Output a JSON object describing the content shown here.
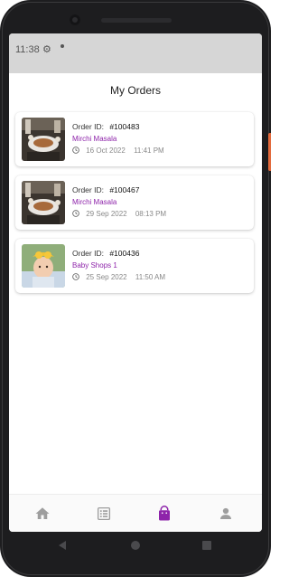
{
  "status_bar": {
    "time": "11:38"
  },
  "header": {
    "title": "My Orders"
  },
  "orders": [
    {
      "id_label": "Order ID:",
      "id": "#100483",
      "restaurant": "Mirchi Masala",
      "date": "16 Oct 2022",
      "time": "11:41 PM"
    },
    {
      "id_label": "Order ID:",
      "id": "#100467",
      "restaurant": "Mirchi Masala",
      "date": "29 Sep 2022",
      "time": "08:13 PM"
    },
    {
      "id_label": "Order ID:",
      "id": "#100436",
      "restaurant": "Baby Shops 1",
      "date": "25 Sep 2022",
      "time": "11:50 AM"
    }
  ],
  "bottom_nav": {
    "items": [
      "home-icon",
      "menu-list-icon",
      "shopping-bag-icon",
      "profile-icon"
    ],
    "active_index": 2
  },
  "colors": {
    "accent": "#8e24aa",
    "inactive_icon": "#9e9e9e",
    "status_bar_bg": "#d6d6d6"
  }
}
